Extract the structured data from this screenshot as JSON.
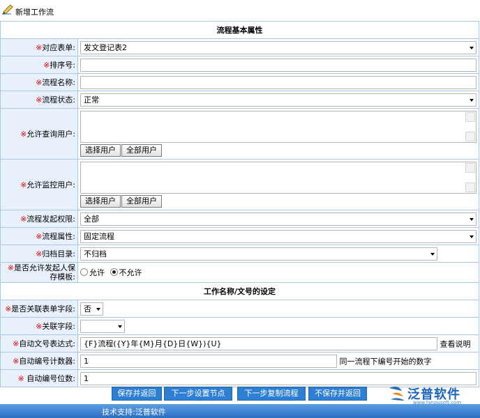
{
  "header": {
    "title": "新增工作流",
    "icon": "pencil-icon"
  },
  "sections": {
    "basic": "流程基本属性",
    "naming": "工作名称/文号的设定"
  },
  "required_mark": "※",
  "fields": {
    "form": {
      "label": "对应表单:",
      "value": "发文登记表2"
    },
    "sort": {
      "label": "排序号:",
      "value": ""
    },
    "name": {
      "label": "流程名称:",
      "value": ""
    },
    "status": {
      "label": "流程状态:",
      "value": "正常"
    },
    "query_users": {
      "label": "允许查询用户:",
      "value": ""
    },
    "monitor_users": {
      "label": "允许监控用户:",
      "value": ""
    },
    "start_perm": {
      "label": "流程发起权限:",
      "value": "全部"
    },
    "attribute": {
      "label": "流程属性:",
      "value": "固定流程"
    },
    "archive": {
      "label": "归档目录:",
      "value": "不归档"
    },
    "save_template": {
      "label": "是否允许发起人保存模板:",
      "options": [
        "允许",
        "不允许"
      ],
      "selected": "不允许"
    },
    "link_field_toggle": {
      "label": "是否关联表单字段:",
      "value": "否"
    },
    "link_field": {
      "label": "关联字段:",
      "value": ""
    },
    "auto_expr": {
      "label": "自动文号表达式:",
      "value": "{F}流程({Y}年{M}月{D}日{W}){U}",
      "help_link": "查看说明"
    },
    "auto_counter": {
      "label": "自动编号计数器:",
      "value": "1",
      "hint": "同一流程下编号开始的数字"
    },
    "auto_digits": {
      "label": " 自动编号位数:",
      "value": "1"
    }
  },
  "user_buttons": {
    "select": "选择用户",
    "all": "全部用户"
  },
  "actions": {
    "save_return": "保存并返回",
    "next_node": "下一步设置节点",
    "next_copy": "下一步复制流程",
    "nosave_return": "不保存并返回"
  },
  "logo": {
    "brand": "泛普软件",
    "url": "www.fanpusoft.com"
  },
  "footer": {
    "support": "技术支持:泛普软件"
  },
  "colors": {
    "label_bg": "#e8f1fb",
    "border": "#a8c9e6",
    "required": "#e10000",
    "action_bg": "#2e7fd1",
    "bottom_bar": "#3a82d2"
  }
}
